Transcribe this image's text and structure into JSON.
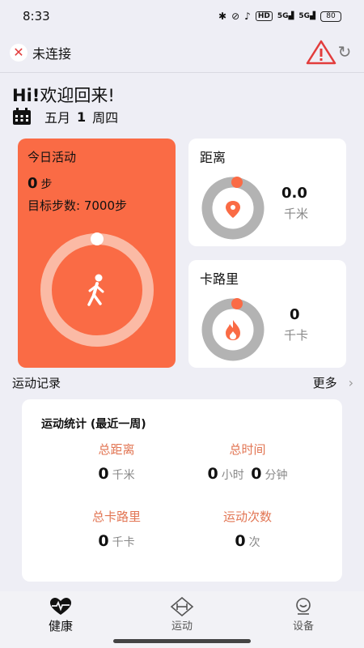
{
  "status_bar": {
    "time": "8:33",
    "network_1": "5G",
    "network_2": "5G",
    "battery": "80"
  },
  "top_bar": {
    "connection_label": "未连接"
  },
  "greeting": {
    "hi": "Hi!",
    "text": "欢迎回来!"
  },
  "date": {
    "month": "五月",
    "day": "1",
    "weekday": "周四"
  },
  "activity": {
    "title": "今日活动",
    "steps": "0",
    "steps_unit": "步",
    "goal_label": "目标步数: 7000步",
    "progress": 0
  },
  "distance": {
    "title": "距离",
    "value": "0.0",
    "unit": "千米",
    "progress": 0
  },
  "calories": {
    "title": "卡路里",
    "value": "0",
    "unit": "千卡",
    "progress": 0
  },
  "section": {
    "title": "运动记录",
    "more": "更多"
  },
  "stats": {
    "title": "运动统计 (最近一周)",
    "total_distance": {
      "label": "总距离",
      "value": "0",
      "unit": "千米"
    },
    "total_time": {
      "label": "总时间",
      "hours": "0",
      "hours_unit": "小时",
      "minutes": "0",
      "minutes_unit": "分钟"
    },
    "total_calories": {
      "label": "总卡路里",
      "value": "0",
      "unit": "千卡"
    },
    "workout_count": {
      "label": "运动次数",
      "value": "0",
      "unit": "次"
    }
  },
  "nav": {
    "health": "健康",
    "sport": "运动",
    "device": "设备"
  },
  "colors": {
    "accent": "#fa6b45",
    "ring_gray": "#b3b3b3",
    "stat_label": "#e27553",
    "warning": "#e23c3c"
  }
}
